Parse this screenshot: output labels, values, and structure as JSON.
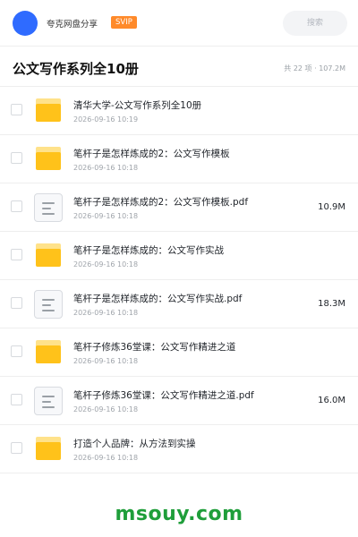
{
  "header": {
    "brand": "夸克网盘分享",
    "badge": "SVIP",
    "search_label": "搜索"
  },
  "folder_title": "公文写作系列全10册",
  "stats": "共 22 项 · 107.2M",
  "files": [
    {
      "name": "清华大学-公文写作系列全10册",
      "date": "2026-09-16 10:19",
      "type": "folder",
      "size": ""
    },
    {
      "name": "笔杆子是怎样炼成的2：公文写作模板",
      "date": "2026-09-16 10:18",
      "type": "folder",
      "size": ""
    },
    {
      "name": "笔杆子是怎样炼成的2：公文写作模板.pdf",
      "date": "2026-09-16 10:18",
      "type": "pdf",
      "size": "10.9M"
    },
    {
      "name": "笔杆子是怎样炼成的：公文写作实战",
      "date": "2026-09-16 10:18",
      "type": "folder",
      "size": ""
    },
    {
      "name": "笔杆子是怎样炼成的：公文写作实战.pdf",
      "date": "2026-09-16 10:18",
      "type": "pdf",
      "size": "18.3M"
    },
    {
      "name": "笔杆子修炼36堂课：公文写作精进之道",
      "date": "2026-09-16 10:18",
      "type": "folder",
      "size": ""
    },
    {
      "name": "笔杆子修炼36堂课：公文写作精进之道.pdf",
      "date": "2026-09-16 10:18",
      "type": "pdf",
      "size": "16.0M"
    },
    {
      "name": "打造个人品牌：从方法到实操",
      "date": "2026-09-16 10:18",
      "type": "folder",
      "size": ""
    }
  ],
  "watermark": "msouy.com",
  "colors": {
    "avatar": "#2f6bff",
    "badge": "#ff8a2a",
    "folder": "#ffc21a",
    "watermark": "#1f9e3a"
  }
}
